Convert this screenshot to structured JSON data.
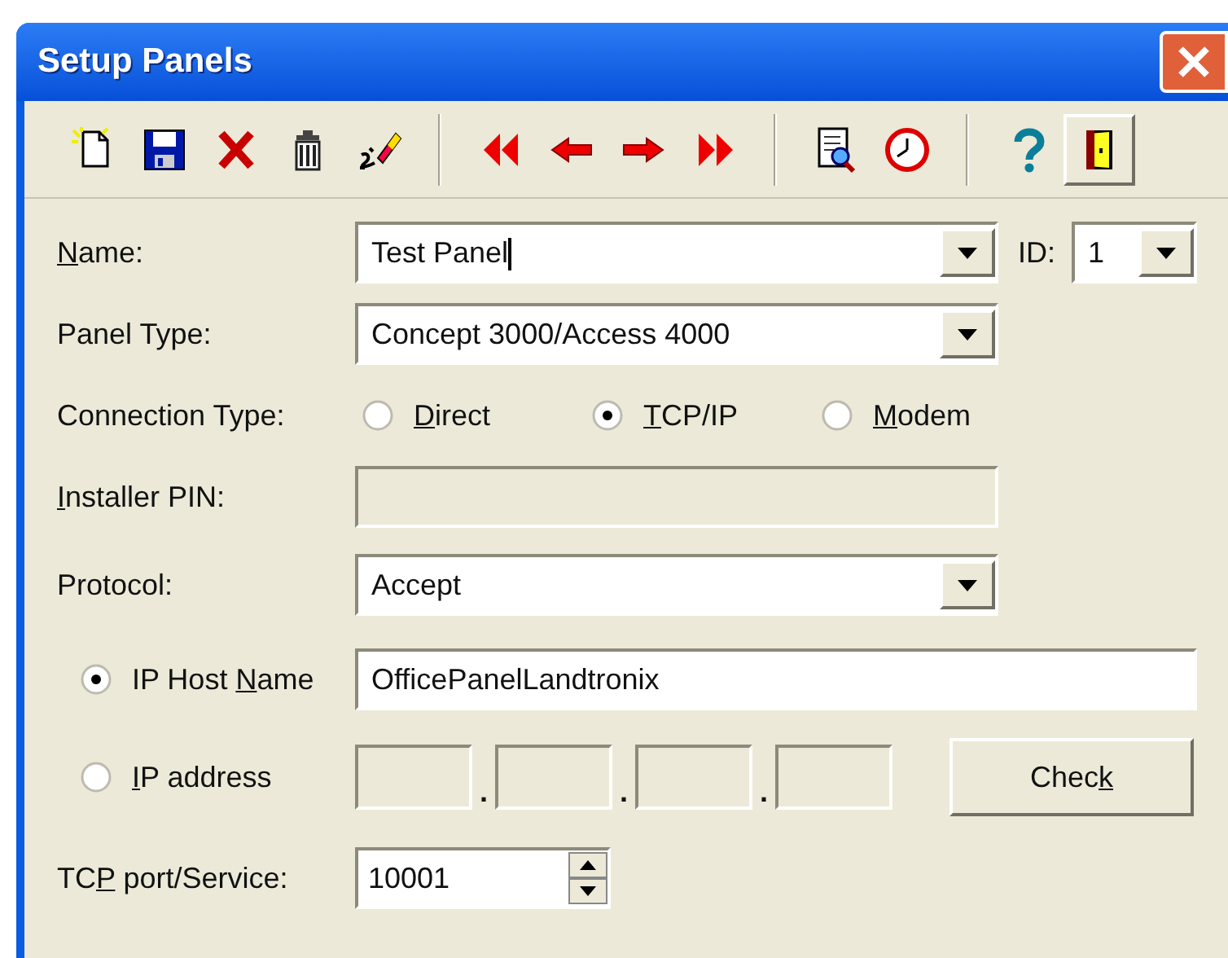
{
  "window": {
    "title": "Setup Panels"
  },
  "toolbar": [
    {
      "kind": "new",
      "raised": false
    },
    {
      "kind": "save",
      "raised": false
    },
    {
      "kind": "cancel",
      "raised": false
    },
    {
      "kind": "delete",
      "raised": false
    },
    {
      "kind": "clear",
      "raised": false
    },
    {
      "kind": "separator"
    },
    {
      "kind": "first",
      "raised": false
    },
    {
      "kind": "previous",
      "raised": false
    },
    {
      "kind": "next",
      "raised": false
    },
    {
      "kind": "last",
      "raised": false
    },
    {
      "kind": "separator"
    },
    {
      "kind": "report",
      "raised": false
    },
    {
      "kind": "clock",
      "raised": false
    },
    {
      "kind": "separator"
    },
    {
      "kind": "help",
      "raised": false
    },
    {
      "kind": "exit",
      "raised": true
    }
  ],
  "name": {
    "label": [
      {
        "text": "N",
        "underline": true
      },
      {
        "text": "ame:",
        "underline": false
      }
    ],
    "value": "Test Panel"
  },
  "id": {
    "label": "ID:",
    "value": "1"
  },
  "panel_type": {
    "label": "Panel Type:",
    "value": "Concept 3000/Access 4000"
  },
  "connection_type": {
    "label": "Connection Type:",
    "options": [
      {
        "label": [
          {
            "text": "D",
            "underline": true
          },
          {
            "text": "irect",
            "underline": false
          }
        ],
        "selected": false
      },
      {
        "label": [
          {
            "text": "T",
            "underline": true
          },
          {
            "text": "CP/IP",
            "underline": false
          }
        ],
        "selected": true
      },
      {
        "label": [
          {
            "text": "M",
            "underline": true
          },
          {
            "text": "odem",
            "underline": false
          }
        ],
        "selected": false
      }
    ]
  },
  "installer_pin": {
    "label": [
      {
        "text": "I",
        "underline": true
      },
      {
        "text": "nstaller PIN:",
        "underline": false
      }
    ],
    "disabled": true
  },
  "protocol": {
    "label": "Protocol:",
    "value": "Accept"
  },
  "ip_host_name": {
    "label": [
      {
        "text": "IP Host ",
        "underline": false
      },
      {
        "text": "N",
        "underline": true
      },
      {
        "text": "ame",
        "underline": false
      }
    ],
    "selected": true,
    "value": "OfficePanelLandtronix"
  },
  "ip_address": {
    "label": [
      {
        "text": "I",
        "underline": true
      },
      {
        "text": "P address",
        "underline": false
      }
    ],
    "selected": false,
    "separators": [
      ".",
      ".",
      "."
    ]
  },
  "check_button": {
    "label": [
      {
        "text": "Chec",
        "underline": false
      },
      {
        "text": "k",
        "underline": true
      }
    ]
  },
  "tcp_port": {
    "label": [
      {
        "text": "TC",
        "underline": false
      },
      {
        "text": "P",
        "underline": true
      },
      {
        "text": " port/Service:",
        "underline": false
      }
    ],
    "value": "10001"
  }
}
